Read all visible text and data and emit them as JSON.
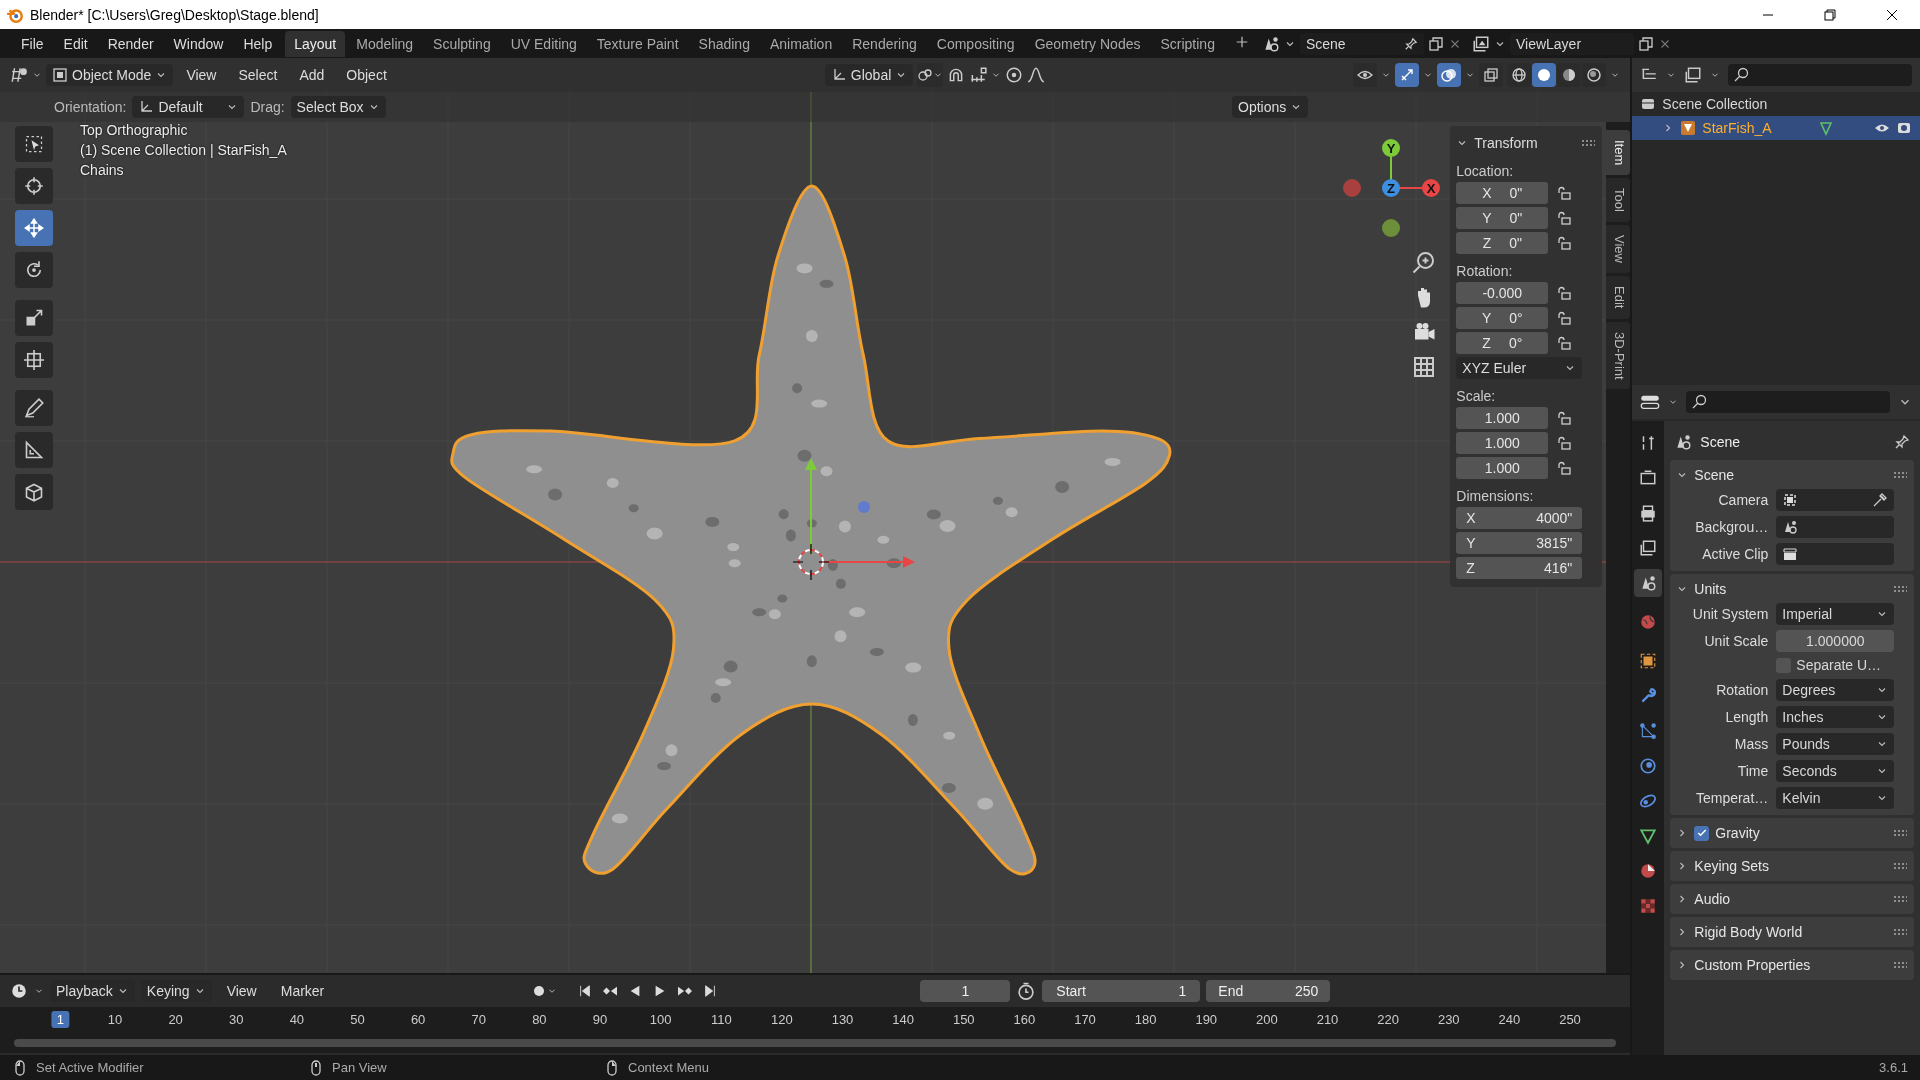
{
  "window": {
    "title": "Blender* [C:\\Users\\Greg\\Desktop\\Stage.blend]"
  },
  "menu": [
    "File",
    "Edit",
    "Render",
    "Window",
    "Help"
  ],
  "workspaces": [
    {
      "label": "Layout",
      "selected": true
    },
    {
      "label": "Modeling",
      "selected": false
    },
    {
      "label": "Sculpting",
      "selected": false
    },
    {
      "label": "UV Editing",
      "selected": false
    },
    {
      "label": "Texture Paint",
      "selected": false
    },
    {
      "label": "Shading",
      "selected": false
    },
    {
      "label": "Animation",
      "selected": false
    },
    {
      "label": "Rendering",
      "selected": false
    },
    {
      "label": "Compositing",
      "selected": false
    },
    {
      "label": "Geometry Nodes",
      "selected": false
    },
    {
      "label": "Scripting",
      "selected": false
    }
  ],
  "scene": "Scene",
  "view_layer": "ViewLayer",
  "viewport": {
    "mode": "Object Mode",
    "menus": [
      "View",
      "Select",
      "Add",
      "Object"
    ],
    "orientation": "Global",
    "toggles": [
      {
        "kind": "selectability",
        "on": false
      },
      {
        "kind": "gizmo",
        "on": true
      },
      {
        "kind": "overlay",
        "on": true
      },
      {
        "kind": "xray",
        "on": false
      }
    ],
    "shading": [
      {
        "kind": "wireframe",
        "selected": false
      },
      {
        "kind": "solid",
        "selected": true
      },
      {
        "kind": "material",
        "selected": false
      },
      {
        "kind": "rendered",
        "selected": false
      }
    ],
    "tool_settings": {
      "orientation_label": "Orientation:",
      "orientation": "Default",
      "drag_label": "Drag:",
      "drag": "Select Box",
      "options": "Options"
    },
    "tools": [
      {
        "kind": "select",
        "selected": false
      },
      {
        "kind": "cursor",
        "selected": false
      },
      {
        "kind": "move",
        "selected": true
      },
      {
        "kind": "rotate",
        "selected": false
      },
      {
        "kind": "scale",
        "selected": false
      },
      {
        "kind": "transform",
        "selected": false
      },
      {
        "kind": "annotate",
        "selected": false
      },
      {
        "kind": "measure",
        "selected": false
      },
      {
        "kind": "add_cube",
        "selected": false
      }
    ],
    "info": [
      "Top Orthographic",
      "(1) Scene Collection | StarFish_A",
      "Chains"
    ],
    "gizmo_axes": [
      "Y",
      "Z",
      "X"
    ]
  },
  "sidebar": {
    "tabs": [
      {
        "label": "Item",
        "selected": true
      },
      {
        "label": "Tool",
        "selected": false
      },
      {
        "label": "View",
        "selected": false
      },
      {
        "label": "Edit",
        "selected": false
      },
      {
        "label": "3D-Print",
        "selected": false
      }
    ],
    "panel": {
      "title": "Transform",
      "expanded": true,
      "groups": [
        {
          "label": "Location:",
          "kind": "lockable",
          "fields": [
            {
              "axis": "X",
              "value": "0\""
            },
            {
              "axis": "Y",
              "value": "0\""
            },
            {
              "axis": "Z",
              "value": "0\""
            }
          ]
        },
        {
          "label": "Rotation:",
          "kind": "lockable",
          "mode": "XYZ Euler",
          "fields": [
            {
              "value": "-0.000"
            },
            {
              "axis": "Y",
              "value": "0°"
            },
            {
              "axis": "Z",
              "value": "0°"
            }
          ]
        },
        {
          "label": "Scale:",
          "kind": "lockable",
          "fields": [
            {
              "value": "1.000"
            },
            {
              "value": "1.000"
            },
            {
              "value": "1.000"
            }
          ]
        },
        {
          "label": "Dimensions:",
          "kind": "plain",
          "fields": [
            {
              "axis": "X",
              "value": "4000\""
            },
            {
              "axis": "Y",
              "value": "3815\""
            },
            {
              "axis": "Z",
              "value": "416\""
            }
          ]
        }
      ]
    }
  },
  "outliner": {
    "items": [
      {
        "label": "Scene Collection",
        "selected": false,
        "children": [
          {
            "label": "StarFish_A",
            "selected": true,
            "expanded": false
          }
        ]
      }
    ]
  },
  "properties": {
    "context": "Scene",
    "tabs": [
      {
        "kind": "tool",
        "selected": false
      },
      {
        "kind": "render",
        "selected": false
      },
      {
        "kind": "output",
        "selected": false
      },
      {
        "kind": "view_layer",
        "selected": false
      },
      {
        "kind": "scene",
        "selected": true
      },
      {
        "kind": "world",
        "selected": false
      },
      {
        "kind": "object",
        "selected": false
      },
      {
        "kind": "modifiers",
        "selected": false
      },
      {
        "kind": "particles",
        "selected": false
      },
      {
        "kind": "physics",
        "selected": false
      },
      {
        "kind": "constraints",
        "selected": false
      },
      {
        "kind": "data",
        "selected": false
      },
      {
        "kind": "material",
        "selected": false
      },
      {
        "kind": "texture",
        "selected": false
      }
    ],
    "panels": [
      {
        "title": "Scene",
        "expanded": true,
        "rows": [
          {
            "kind": "object_field",
            "label": "Camera"
          },
          {
            "kind": "scene_field",
            "label": "Backgrou…"
          },
          {
            "kind": "clip_field",
            "label": "Active Clip"
          }
        ]
      },
      {
        "title": "Units",
        "expanded": true,
        "rows": [
          {
            "kind": "dropdown",
            "label": "Unit System",
            "value": "Imperial"
          },
          {
            "kind": "number",
            "label": "Unit Scale",
            "value": "1.000000"
          },
          {
            "kind": "checkbox",
            "label": "Separate U…",
            "checked": false
          },
          {
            "kind": "dropdown",
            "label": "Rotation",
            "value": "Degrees"
          },
          {
            "kind": "dropdown",
            "label": "Length",
            "value": "Inches"
          },
          {
            "kind": "dropdown",
            "label": "Mass",
            "value": "Pounds"
          },
          {
            "kind": "dropdown",
            "label": "Time",
            "value": "Seconds"
          },
          {
            "kind": "dropdown",
            "label": "Temperat…",
            "value": "Kelvin"
          }
        ]
      },
      {
        "title": "Gravity",
        "expanded": false,
        "checked": true
      },
      {
        "title": "Keying Sets",
        "expanded": false
      },
      {
        "title": "Audio",
        "expanded": false
      },
      {
        "title": "Rigid Body World",
        "expanded": false
      },
      {
        "title": "Custom Properties",
        "expanded": false
      }
    ]
  },
  "timeline": {
    "menus": [
      "Playback",
      "Keying",
      "View",
      "Marker"
    ],
    "frame": "1",
    "start_label": "Start",
    "start": "1",
    "end_label": "End",
    "end": "250",
    "ruler": [
      {
        "label": "1",
        "selected": true
      },
      {
        "label": "10",
        "selected": false
      },
      {
        "label": "20",
        "selected": false
      },
      {
        "label": "30",
        "selected": false
      },
      {
        "label": "40",
        "selected": false
      },
      {
        "label": "50",
        "selected": false
      },
      {
        "label": "60",
        "selected": false
      },
      {
        "label": "70",
        "selected": false
      },
      {
        "label": "80",
        "selected": false
      },
      {
        "label": "90",
        "selected": false
      },
      {
        "label": "100",
        "selected": false
      },
      {
        "label": "110",
        "selected": false
      },
      {
        "label": "120",
        "selected": false
      },
      {
        "label": "130",
        "selected": false
      },
      {
        "label": "140",
        "selected": false
      },
      {
        "label": "150",
        "selected": false
      },
      {
        "label": "160",
        "selected": false
      },
      {
        "label": "170",
        "selected": false
      },
      {
        "label": "180",
        "selected": false
      },
      {
        "label": "190",
        "selected": false
      },
      {
        "label": "200",
        "selected": false
      },
      {
        "label": "210",
        "selected": false
      },
      {
        "label": "220",
        "selected": false
      },
      {
        "label": "230",
        "selected": false
      },
      {
        "label": "240",
        "selected": false
      },
      {
        "label": "250",
        "selected": false
      }
    ]
  },
  "status_bar": {
    "hints": [
      {
        "kind": "left_click",
        "text": "Set Active Modifier"
      },
      {
        "kind": "middle_click",
        "text": "Pan View"
      },
      {
        "kind": "right_click",
        "text": "Context Menu"
      }
    ],
    "version": "3.6.1"
  }
}
